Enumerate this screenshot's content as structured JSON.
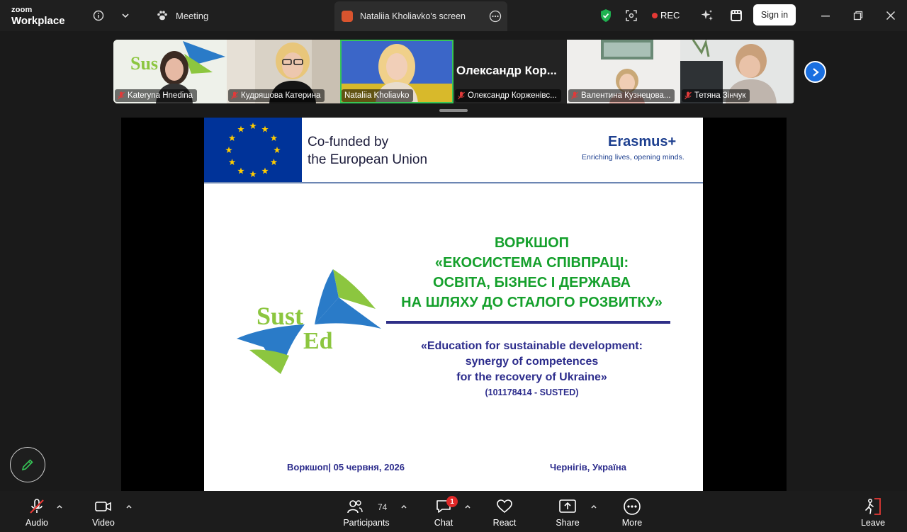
{
  "app": {
    "logo_line1": "zoom",
    "logo_line2": "Workplace"
  },
  "titlebar": {
    "meeting_label": "Meeting",
    "screen_tab_label": "Nataliia Kholiavko's screen",
    "rec_label": "REC",
    "signin_label": "Sign in"
  },
  "participants": [
    {
      "name": "Kateryna Hnedina"
    },
    {
      "name": "Кудряшова Катерина"
    },
    {
      "name": "Nataliia Kholiavko"
    },
    {
      "name": "Олександр Корженівс...",
      "big_name": "Олександр  Кор..."
    },
    {
      "name": "Валентина Кузнецова..."
    },
    {
      "name": "Тетяна Зінчук"
    }
  ],
  "slide": {
    "cofunded_line1": "Co-funded by",
    "cofunded_line2": "the European Union",
    "erasmus": "Erasmus+",
    "erasmus_tagline": "Enriching lives, opening minds.",
    "logo_word1": "Sust",
    "logo_word2": "Ed",
    "workshop_title": [
      "ВОРКШОП",
      "«ЕКОСИСТЕМА СПІВПРАЦІ:",
      "ОСВІТА, БІЗНЕС І ДЕРЖАВА",
      "НА ШЛЯХУ ДО СТАЛОГО РОЗВИТКУ»"
    ],
    "project_title": [
      "«Education for sustainable development:",
      "synergy of competences",
      "for the recovery of Ukraine»"
    ],
    "project_code": "(101178414 - SUSTED)",
    "footer_left": "Воркшоп| 05 червня, 2026",
    "footer_right": "Чернігів, Україна"
  },
  "toolbar": {
    "audio": "Audio",
    "video": "Video",
    "participants": "Participants",
    "participants_count": "74",
    "chat": "Chat",
    "chat_badge": "1",
    "react": "React",
    "share": "Share",
    "more": "More",
    "leave": "Leave"
  },
  "colors": {
    "accent_green": "#36c657",
    "rec_red": "#e53935",
    "slide_green": "#15a02c",
    "slide_navy": "#2c2c8c",
    "eu_blue": "#003399"
  }
}
